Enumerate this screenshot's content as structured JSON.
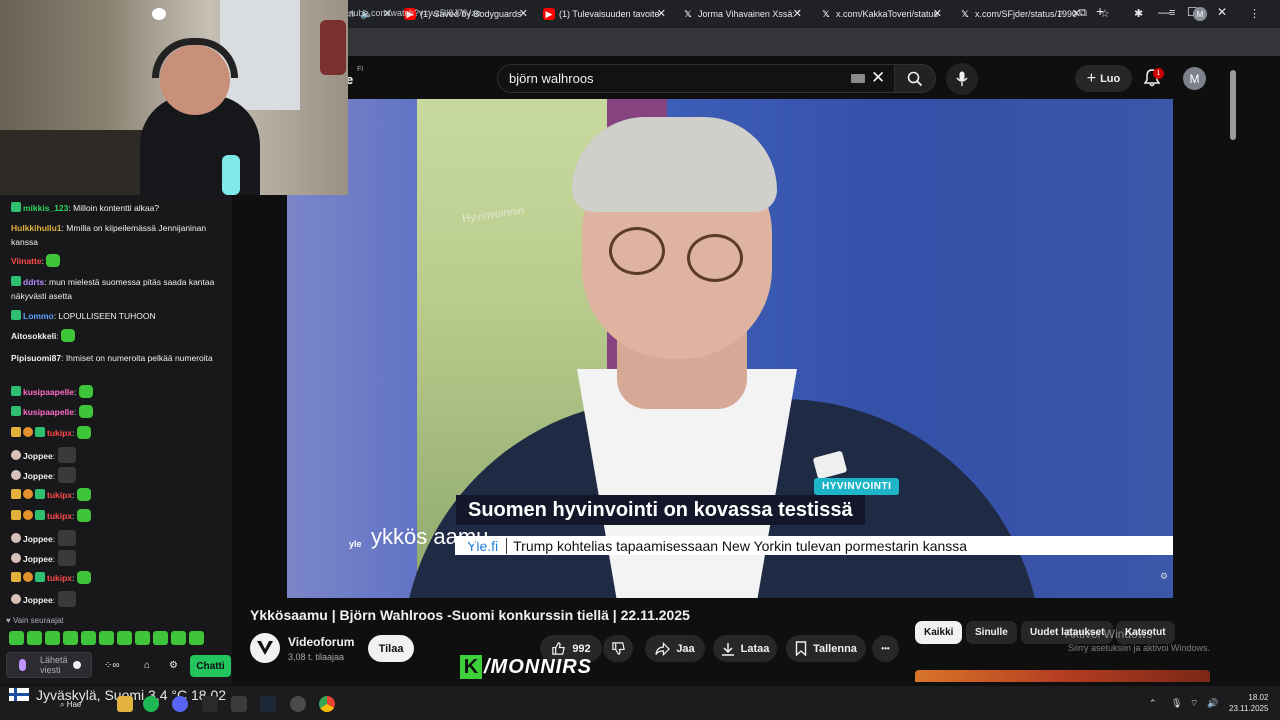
{
  "browser": {
    "tabs": [
      {
        "label": "(1) Saved by Bodyguards",
        "icon": "youtube"
      },
      {
        "label": "(1) Tulevaisuuden tavoite",
        "icon": "youtube"
      },
      {
        "label": "Jorma Vihavainen Xssä: '",
        "icon": "x"
      },
      {
        "label": "x.com/KakkaToveri/status",
        "icon": "x"
      },
      {
        "label": "x.com/SFjder/status/1990",
        "icon": "x"
      }
    ],
    "first_tab_fragment": "rn",
    "new_tab": "+",
    "url": "utube.com/watch?v=wzRl8J7fVzo",
    "profile_letter": "M"
  },
  "youtube": {
    "logo_fragment": "e",
    "logo_region": "FI",
    "search_query": "björn walhroos",
    "create_label": "Luo",
    "notification_count": "1",
    "avatar_letter": "M",
    "video": {
      "bg_text": "Hyvinvoinnin",
      "tag": "HYVINVOINTI",
      "headline": "Suomen hyvinvointi on kovassa testissä",
      "ticker_source": "Yle.fi",
      "ticker_text": "Trump kohtelias tapaamisessaan New Yorkin tulevan pormestarin kanssa",
      "brand_small": "yle",
      "brand_show": "ykkös aamu"
    },
    "title": "Ykkösaamu | Björn Wahlroos -Suomi konkurssin tiellä | 22.11.2025",
    "channel_name": "Videoforum",
    "channel_subs": "3,08 t. tilaajaa",
    "subscribe_label": "Tilaa",
    "likes": "992",
    "share_label": "Jaa",
    "download_label": "Lataa",
    "save_label": "Tallenna",
    "more_label": "•••",
    "filters": [
      "Kaikki",
      "Sinulle",
      "Uudet lataukset",
      "Katsotut"
    ],
    "activate_line1": "Aktivoi Windows",
    "activate_line2": "Siirry asetuksiin ja aktivoi Windows."
  },
  "overlay": {
    "watermark_k": "K",
    "watermark_text": "/MONNIRS"
  },
  "chat": {
    "messages": [
      {
        "user": "mikkis_123",
        "color": "#2fd65e",
        "text": " Milloin kontentti alkaa?",
        "badges": [
          "g"
        ],
        "emote": false
      },
      {
        "user": "Hulkkihullu1",
        "color": "#e2b13c",
        "text": " Mmilla on kiipeilemässä Jennijaninan kanssa",
        "badges": [],
        "emote": false
      },
      {
        "user": "Viinatte",
        "color": "#ff4a4a",
        "text": " ",
        "badges": [],
        "emote": true
      },
      {
        "user": "ddrts",
        "color": "#b58cff",
        "text": " mun mielestä suomessa pitäs saada kantaa näkyvästi asetta",
        "badges": [
          "g"
        ],
        "emote": false
      },
      {
        "user": "Lommo",
        "color": "#5aa0ff",
        "text": " LOPULLISEEN TUHOON",
        "badges": [
          "g"
        ],
        "emote": false
      },
      {
        "user": "Aitosokkeli",
        "color": "#f1f1f1",
        "text": " ",
        "badges": [],
        "emote": true
      },
      {
        "user": "Pipisuomi87",
        "color": "#f1f1f1",
        "text": " Ihmiset on numeroita pelkää numeroita",
        "badges": [],
        "emote": false
      },
      {
        "user": "kusipaapelle",
        "color": "#ff6ec7",
        "text": " ",
        "badges": [
          "g"
        ],
        "emote": true
      },
      {
        "user": "kusipaapelle",
        "color": "#ff6ec7",
        "text": " ",
        "badges": [
          "g"
        ],
        "emote": true
      },
      {
        "user": "tukipx",
        "color": "#ff4a4a",
        "text": " ",
        "badges": [
          "y",
          "o",
          "g"
        ],
        "emote": true
      },
      {
        "user": "Joppee",
        "color": "#f1f1f1",
        "text": " ",
        "badges": [
          "a"
        ],
        "emote": false
      },
      {
        "user": "Joppee",
        "color": "#f1f1f1",
        "text": " ",
        "badges": [
          "a"
        ],
        "emote": false
      },
      {
        "user": "tukipx",
        "color": "#ff4a4a",
        "text": " ",
        "badges": [
          "y",
          "o",
          "g"
        ],
        "emote": true
      },
      {
        "user": "tukipx",
        "color": "#ff4a4a",
        "text": " ",
        "badges": [
          "y",
          "o",
          "g"
        ],
        "emote": true
      },
      {
        "user": "Joppee",
        "color": "#f1f1f1",
        "text": " ",
        "badges": [
          "a"
        ],
        "emote": false
      },
      {
        "user": "Joppee",
        "color": "#f1f1f1",
        "text": " ",
        "badges": [
          "a"
        ],
        "emote": false
      },
      {
        "user": "tukipx",
        "color": "#ff4a4a",
        "text": " ",
        "badges": [
          "y",
          "o",
          "g"
        ],
        "emote": true
      },
      {
        "user": "Joppee",
        "color": "#f1f1f1",
        "text": " ",
        "badges": [
          "a"
        ],
        "emote": false
      }
    ],
    "follow_note": "♥ Vain seuraajat",
    "input_placeholder": "Lähetä viesti",
    "send_label": "Chatti"
  },
  "taskbar": {
    "weather_city": "Jyväskylä, Suomi",
    "weather_temp": "3,4 °C",
    "weather_extra": "18.02",
    "search_label": "Hae",
    "time": "18.02",
    "date": "23.11.2025"
  },
  "colors": {
    "yt_bg": "#0f0f0f",
    "chat_bg": "#18181b",
    "chat_button": "#22c55e",
    "tag_cyan": "#1fb5c8",
    "ticker_link": "#1f7fd6"
  }
}
